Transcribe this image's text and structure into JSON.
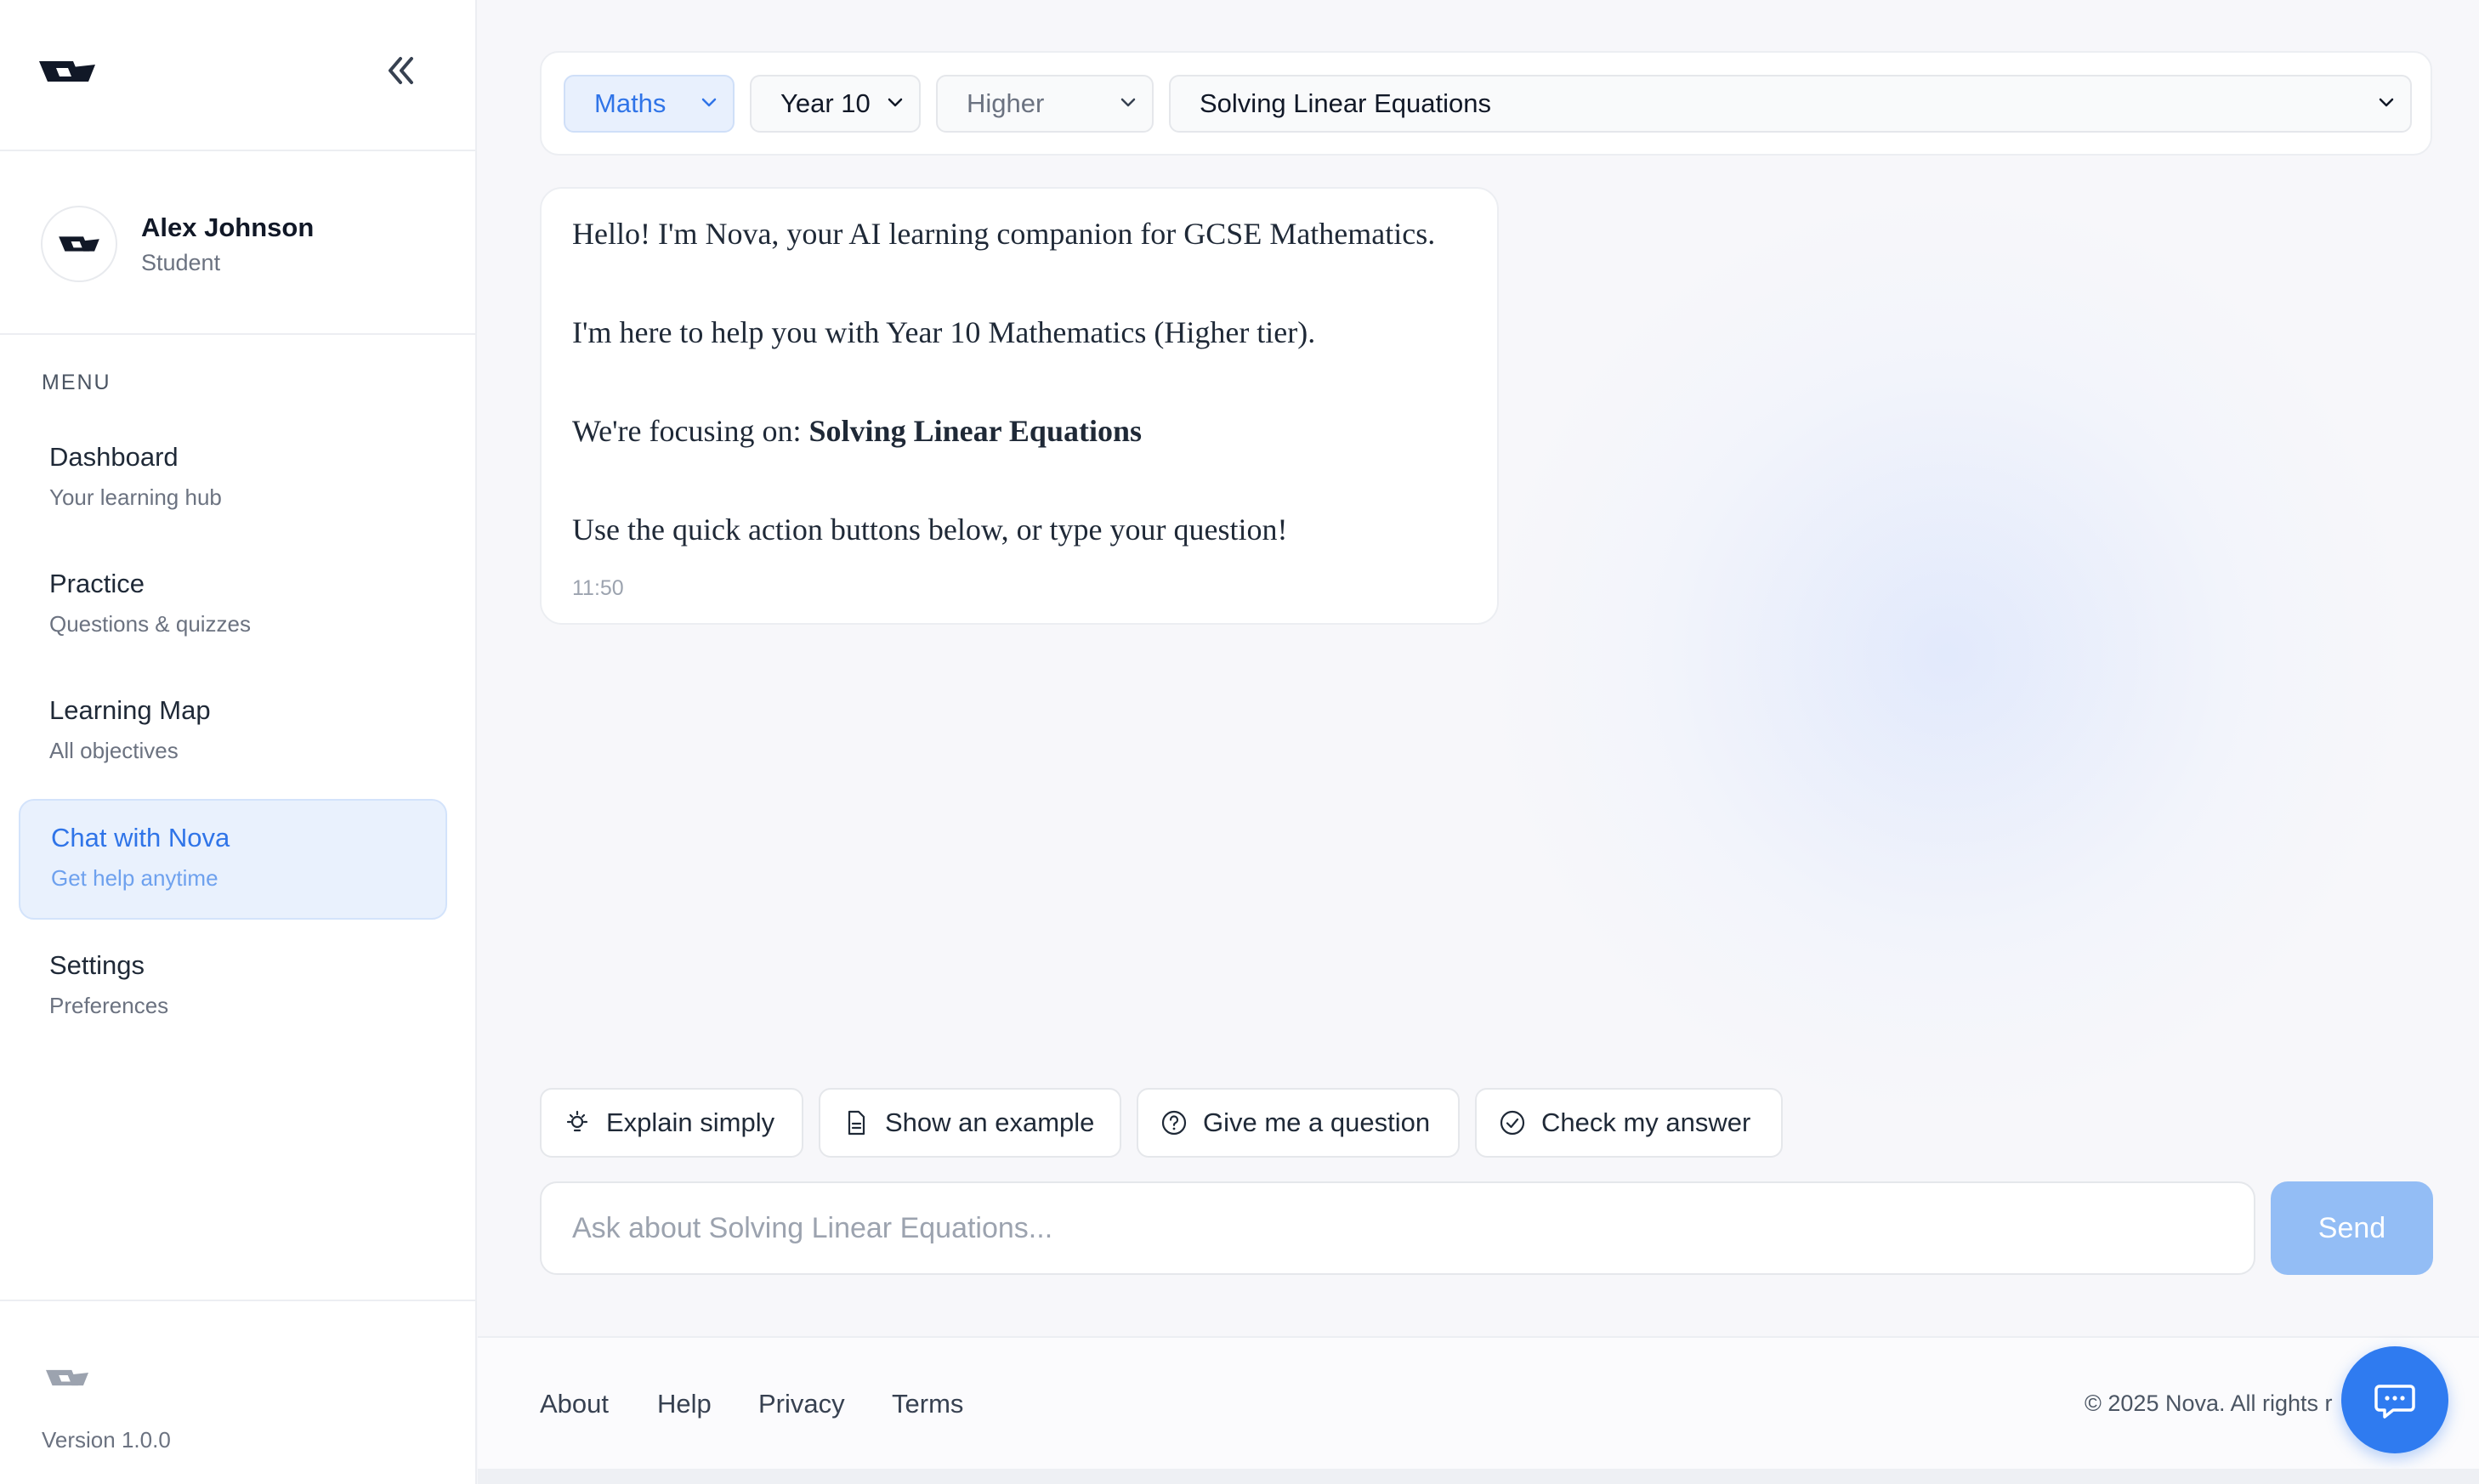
{
  "sidebar": {
    "user": {
      "name": "Alex Johnson",
      "role": "Student"
    },
    "menu_heading": "MENU",
    "items": [
      {
        "label": "Dashboard",
        "sub": "Your learning hub",
        "icon": "dashboard-icon"
      },
      {
        "label": "Practice",
        "sub": "Questions & quizzes",
        "icon": "practice-icon"
      },
      {
        "label": "Learning Map",
        "sub": "All objectives",
        "icon": "map-icon"
      },
      {
        "label": "Chat with Nova",
        "sub": "Get help anytime",
        "icon": "chat-icon",
        "active": true
      },
      {
        "label": "Settings",
        "sub": "Preferences",
        "icon": "settings-icon"
      }
    ],
    "version": "Version 1.0.0"
  },
  "filters": {
    "subject": "Maths",
    "year": "Year 10",
    "tier": "Higher",
    "topic": "Solving Linear Equations"
  },
  "chat": {
    "messages": [
      {
        "line1": "Hello! I'm Nova, your AI learning companion for GCSE Mathematics.",
        "line2": "I'm here to help you with Year 10 Mathematics (Higher tier).",
        "line3_prefix": "We're focusing on: ",
        "line3_topic": "Solving Linear Equations",
        "line4": "Use the quick action buttons below, or type your question!",
        "time": "11:50"
      }
    ],
    "quick_actions": [
      {
        "label": "Explain simply",
        "icon": "lightbulb-icon"
      },
      {
        "label": "Show an example",
        "icon": "document-icon"
      },
      {
        "label": "Give me a question",
        "icon": "question-circle-icon"
      },
      {
        "label": "Check my answer",
        "icon": "check-circle-icon"
      }
    ],
    "input_placeholder": "Ask about Solving Linear Equations...",
    "send_label": "Send"
  },
  "footer": {
    "links": [
      "About",
      "Help",
      "Privacy",
      "Terms"
    ],
    "copyright": "© 2025 Nova. All rights r"
  },
  "colors": {
    "accent": "#2f74e8",
    "active_bg": "#e9f1fd",
    "send_disabled": "#93bdf5",
    "fab": "#2f7bf0"
  }
}
